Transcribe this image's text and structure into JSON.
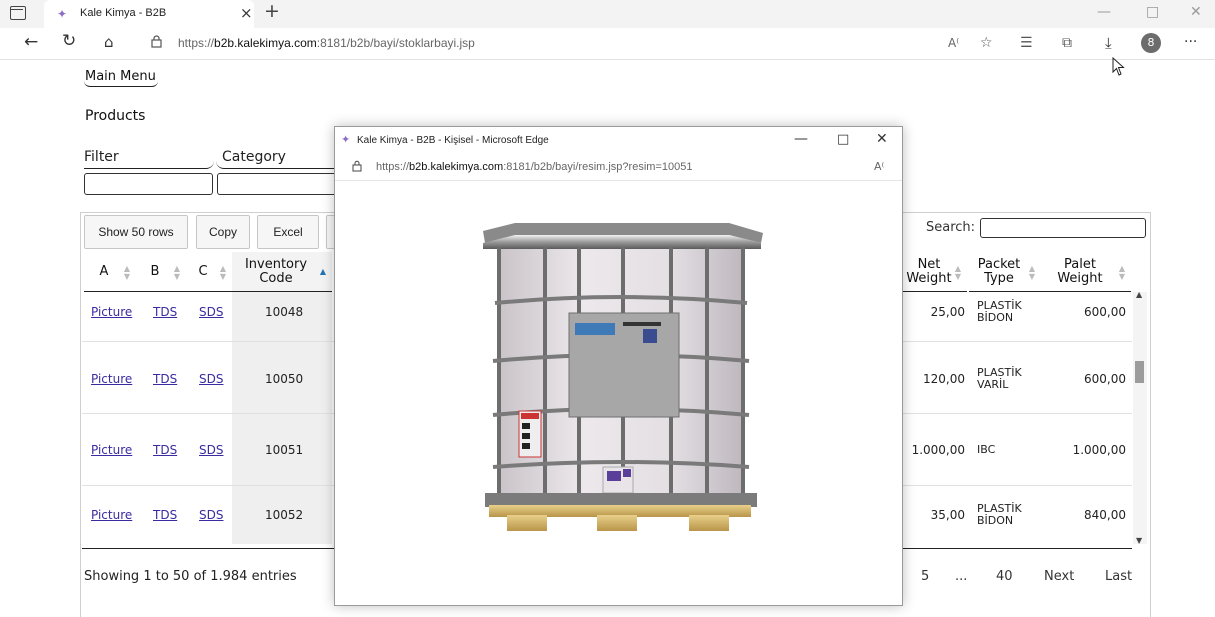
{
  "browser": {
    "tab_title": "Kale Kimya - B2B",
    "url_prefix": "https://",
    "url_host": "b2b.kalekimya.com",
    "url_path": ":8181/b2b/bayi/stoklarbayi.jsp",
    "profile_initial": "8",
    "read_aloud_label": "Aᵀ",
    "more_label": "···"
  },
  "page": {
    "main_menu": "Main Menu",
    "title": "Products",
    "filter_label": "Filter",
    "category_label": "Category"
  },
  "toolbar": {
    "show_rows": "Show 50 rows",
    "copy": "Copy",
    "excel": "Excel",
    "search_label": "Search:"
  },
  "table": {
    "headers": {
      "a": "A",
      "b": "B",
      "c": "C",
      "inventory_code_1": "Inventory",
      "inventory_code_2": "Code",
      "net_weight_1": "Net",
      "net_weight_2": "Weight",
      "packet_type_1": "Packet",
      "packet_type_2": "Type",
      "palet_weight_1": "Palet",
      "palet_weight_2": "Weight"
    },
    "rows": [
      {
        "a": "Picture",
        "b": "TDS",
        "c": "SDS",
        "code": "10048",
        "net_weight": "25,00",
        "packet_1": "PLASTİK",
        "packet_2": "BİDON",
        "palet_weight": "600,00"
      },
      {
        "a": "Picture",
        "b": "TDS",
        "c": "SDS",
        "code": "10050",
        "net_weight": "120,00",
        "packet_1": "PLASTİK",
        "packet_2": "VARİL",
        "palet_weight": "600,00"
      },
      {
        "a": "Picture",
        "b": "TDS",
        "c": "SDS",
        "code": "10051",
        "net_weight": "1.000,00",
        "packet_1": "IBC",
        "packet_2": "",
        "palet_weight": "1.000,00"
      },
      {
        "a": "Picture",
        "b": "TDS",
        "c": "SDS",
        "code": "10052",
        "net_weight": "35,00",
        "packet_1": "PLASTİK",
        "packet_2": "BİDON",
        "palet_weight": "840,00"
      }
    ]
  },
  "footer": {
    "showing": "Showing 1 to 50 of 1.984 entries",
    "pages": {
      "p5": "5",
      "ellipsis": "...",
      "p40": "40",
      "next": "Next",
      "last": "Last"
    }
  },
  "popup": {
    "title": "Kale Kimya - B2B - Kişisel - Microsoft Edge",
    "url_prefix": "https://",
    "url_host": "b2b.kalekimya.com",
    "url_path": ":8181/b2b/bayi/resim.jsp?resim=10051",
    "image_icon": "ibc-container-image"
  },
  "colors": {
    "link": "#3a2ca0",
    "sort_active": "#2573b5"
  }
}
